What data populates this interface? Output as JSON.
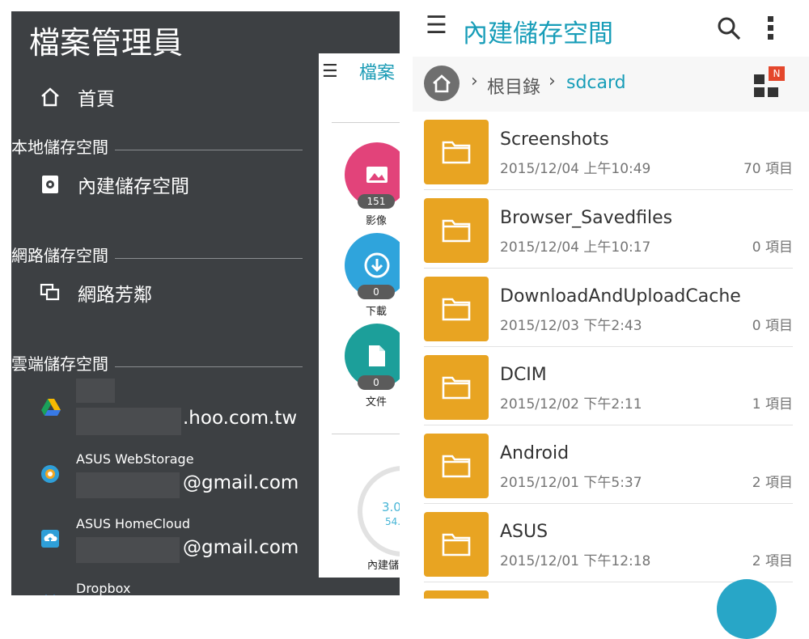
{
  "left_panel": {
    "drawer_title": "檔案管理員",
    "home_label": "首頁",
    "sections": {
      "local": "本地儲存空間",
      "network": "網路儲存空間",
      "cloud": "雲端儲存空間"
    },
    "internal_storage_label": "內建儲存空間",
    "network_neighborhood_label": "網路芳鄰",
    "cloud_accounts": [
      {
        "service": "",
        "email_suffix": ".hoo.com.tw",
        "icon": "google-drive-icon"
      },
      {
        "service": "ASUS WebStorage",
        "email_suffix": "@gmail.com",
        "icon": "asus-webstorage-icon"
      },
      {
        "service": "ASUS HomeCloud",
        "email_suffix": "@gmail.com",
        "icon": "asus-homecloud-icon"
      },
      {
        "service": "Dropbox",
        "email_suffix": "",
        "icon": "dropbox-icon"
      }
    ],
    "peek": {
      "title": "檔案",
      "categories": [
        {
          "label": "影像",
          "count": "151",
          "color": "#e2437a"
        },
        {
          "label": "下載",
          "count": "0",
          "color": "#2fa4dc"
        },
        {
          "label": "文件",
          "count": "0",
          "color": "#1c9f9a"
        }
      ],
      "storage_value": "3.0",
      "storage_sub": "54.",
      "storage_label": "內建儲"
    }
  },
  "right_panel": {
    "title": "內建儲存空間",
    "breadcrumb": {
      "root": "根目錄",
      "current": "sdcard"
    },
    "new_badge": "N",
    "files": [
      {
        "name": "Screenshots",
        "date": "2015/12/04 上午10:49",
        "count": "70 項目"
      },
      {
        "name": "Browser_Savedfiles",
        "date": "2015/12/04 上午10:17",
        "count": "0 項目"
      },
      {
        "name": "DownloadAndUploadCache",
        "date": "2015/12/03 下午2:43",
        "count": "0 項目"
      },
      {
        "name": "DCIM",
        "date": "2015/12/02 下午2:11",
        "count": "1 項目"
      },
      {
        "name": "Android",
        "date": "2015/12/01 下午5:37",
        "count": "2 項目"
      },
      {
        "name": "ASUS",
        "date": "2015/12/01 下午12:18",
        "count": "2 項目"
      }
    ]
  },
  "colors": {
    "accent": "#179db8",
    "folder": "#e8a422",
    "drawer_bg": "#3d4043"
  }
}
